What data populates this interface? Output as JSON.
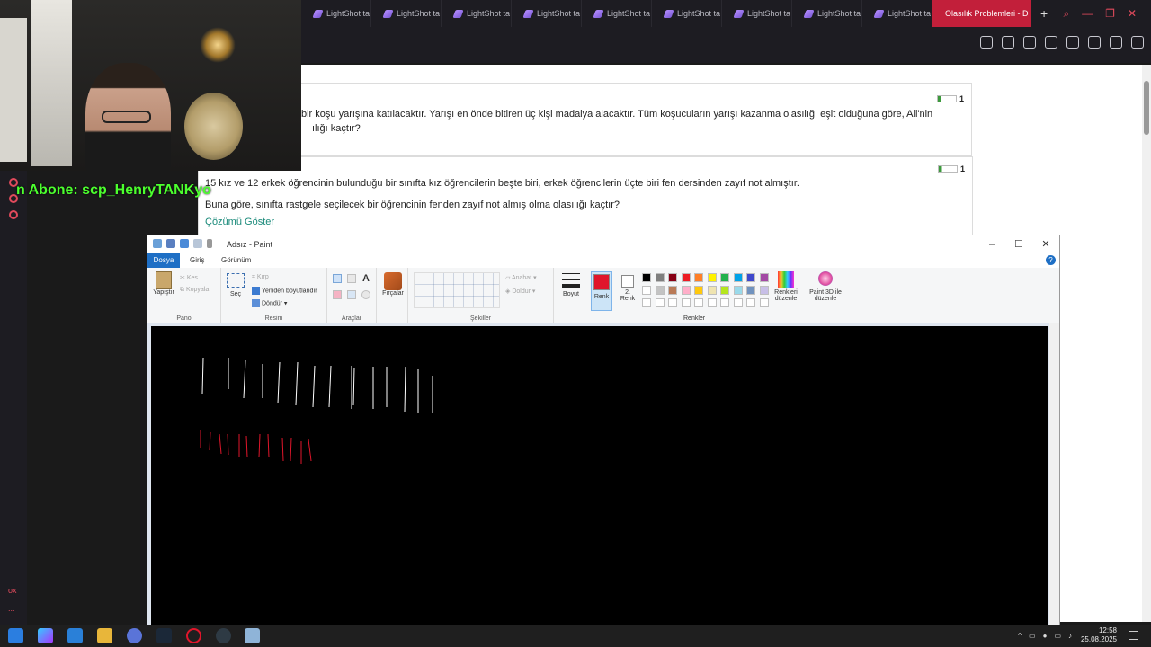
{
  "browser": {
    "tabs": [
      "LightShot ta",
      "LightShot ta",
      "LightShot ta",
      "LightShot ta",
      "LightShot ta",
      "LightShot ta",
      "LightShot ta",
      "LightShot ta",
      "LightShot ta"
    ],
    "active_tab": "Olasılık Problemleri - D",
    "new_tab": "+"
  },
  "overlay": {
    "subscriber_text": "n Abone: scp_HenryTANKyo"
  },
  "questions": [
    {
      "badge": "1",
      "line1": "bir koşu yarışına katılacaktır. Yarışı en önde bitiren üç kişi madalya alacaktır. Tüm koşucuların yarışı kazanma olasılığı eşit olduğuna göre, Ali'nin",
      "line2": "ılığı kaçtır?"
    },
    {
      "badge": "1",
      "line1": "15 kız ve 12 erkek öğrencinin bulunduğu bir sınıfta kız öğrencilerin beşte biri, erkek öğrencilerin üçte biri fen dersinden zayıf not almıştır.",
      "line2": "Buna göre, sınıfta rastgele seçilecek bir öğrencinin fenden zayıf not almış olma olasılığı kaçtır?",
      "link": "Çözümü Göster"
    }
  ],
  "paint": {
    "title": "Adsız - Paint",
    "tabs": {
      "file": "Dosya",
      "home": "Giriş",
      "view": "Görünüm"
    },
    "clipboard": {
      "paste": "Yapıştır",
      "cut": "Kes",
      "copy": "Kopyala",
      "label": "Pano"
    },
    "image": {
      "select": "Seç",
      "crop": "Kırp",
      "resize": "Yeniden boyutlandır",
      "rotate": "Döndür",
      "label": "Resim"
    },
    "tools": {
      "label": "Araçlar"
    },
    "brushes": {
      "label": "Fırçalar"
    },
    "shapes": {
      "outline": "Anahat",
      "fill": "Doldur",
      "label": "Şekiller"
    },
    "size": {
      "label": "Boyut"
    },
    "color1": {
      "label": "Renk",
      "value": "#e0162b"
    },
    "color2": {
      "label": "2.\nRenk",
      "line1": "2.",
      "line2": "Renk",
      "value": "#ffffff"
    },
    "edit_colors": {
      "line1": "Renkleri",
      "line2": "düzenle"
    },
    "paint3d": {
      "line1": "Paint 3D ile",
      "line2": "düzenle"
    },
    "colors_label": "Renkler",
    "palette": [
      "#000000",
      "#7f7f7f",
      "#880015",
      "#ed1c24",
      "#ff7f27",
      "#fff200",
      "#22b14c",
      "#00a2e8",
      "#3f48cc",
      "#a349a4",
      "#ffffff",
      "#c3c3c3",
      "#b97a57",
      "#ffaec9",
      "#ffc90e",
      "#efe4b0",
      "#b5e61d",
      "#99d9ea",
      "#7092be",
      "#c8bfe7"
    ]
  },
  "taskbar": {
    "time": "12:58",
    "date": "25.08.2025"
  },
  "sidebar": {
    "bottom1": "ox",
    "bottom2": "..."
  }
}
